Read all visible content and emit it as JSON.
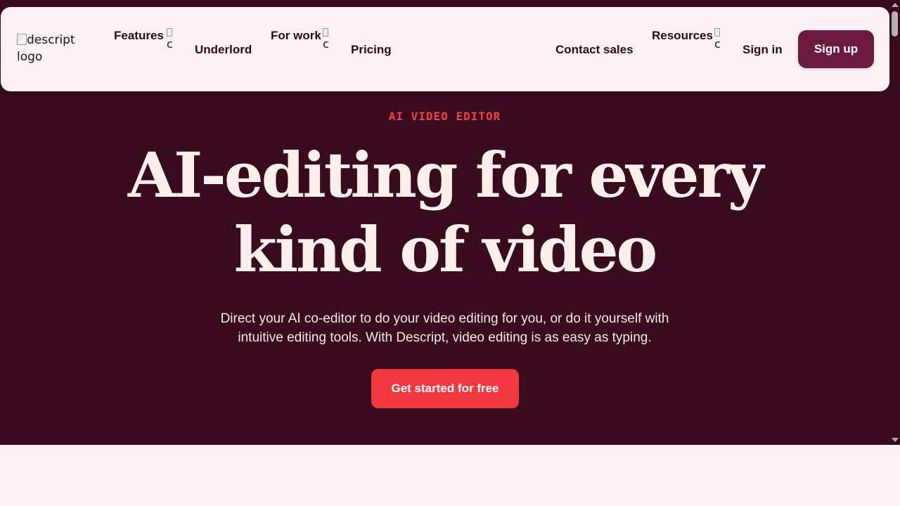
{
  "nav": {
    "logo_alt": "descript logo",
    "items": [
      {
        "label": "Features",
        "has_menu": true,
        "caret_alt": "ci"
      },
      {
        "label": "Underlord",
        "has_menu": false
      },
      {
        "label": "For work",
        "has_menu": true,
        "caret_alt": "ci"
      },
      {
        "label": "Pricing",
        "has_menu": false
      }
    ],
    "right_items": [
      {
        "label": "Contact sales",
        "has_menu": false
      },
      {
        "label": "Resources",
        "has_menu": true,
        "caret_alt": "ci"
      },
      {
        "label": "Sign in",
        "has_menu": false
      }
    ],
    "signup_label": "Sign up"
  },
  "hero": {
    "eyebrow": "AI VIDEO EDITOR",
    "headline_line1": "AI-editing for every",
    "headline_line2": "kind of video",
    "subtext": "Direct your AI co-editor to do your video editing for you, or do it yourself with intuitive editing tools. With Descript, video editing is as easy as typing.",
    "cta_label": "Get started for free"
  },
  "colors": {
    "hero_bg": "#380b1d",
    "nav_bg": "#fdf3f6",
    "accent": "#f2393f",
    "signup_bg": "#6c1b3d",
    "eyebrow": "#f2414b"
  }
}
